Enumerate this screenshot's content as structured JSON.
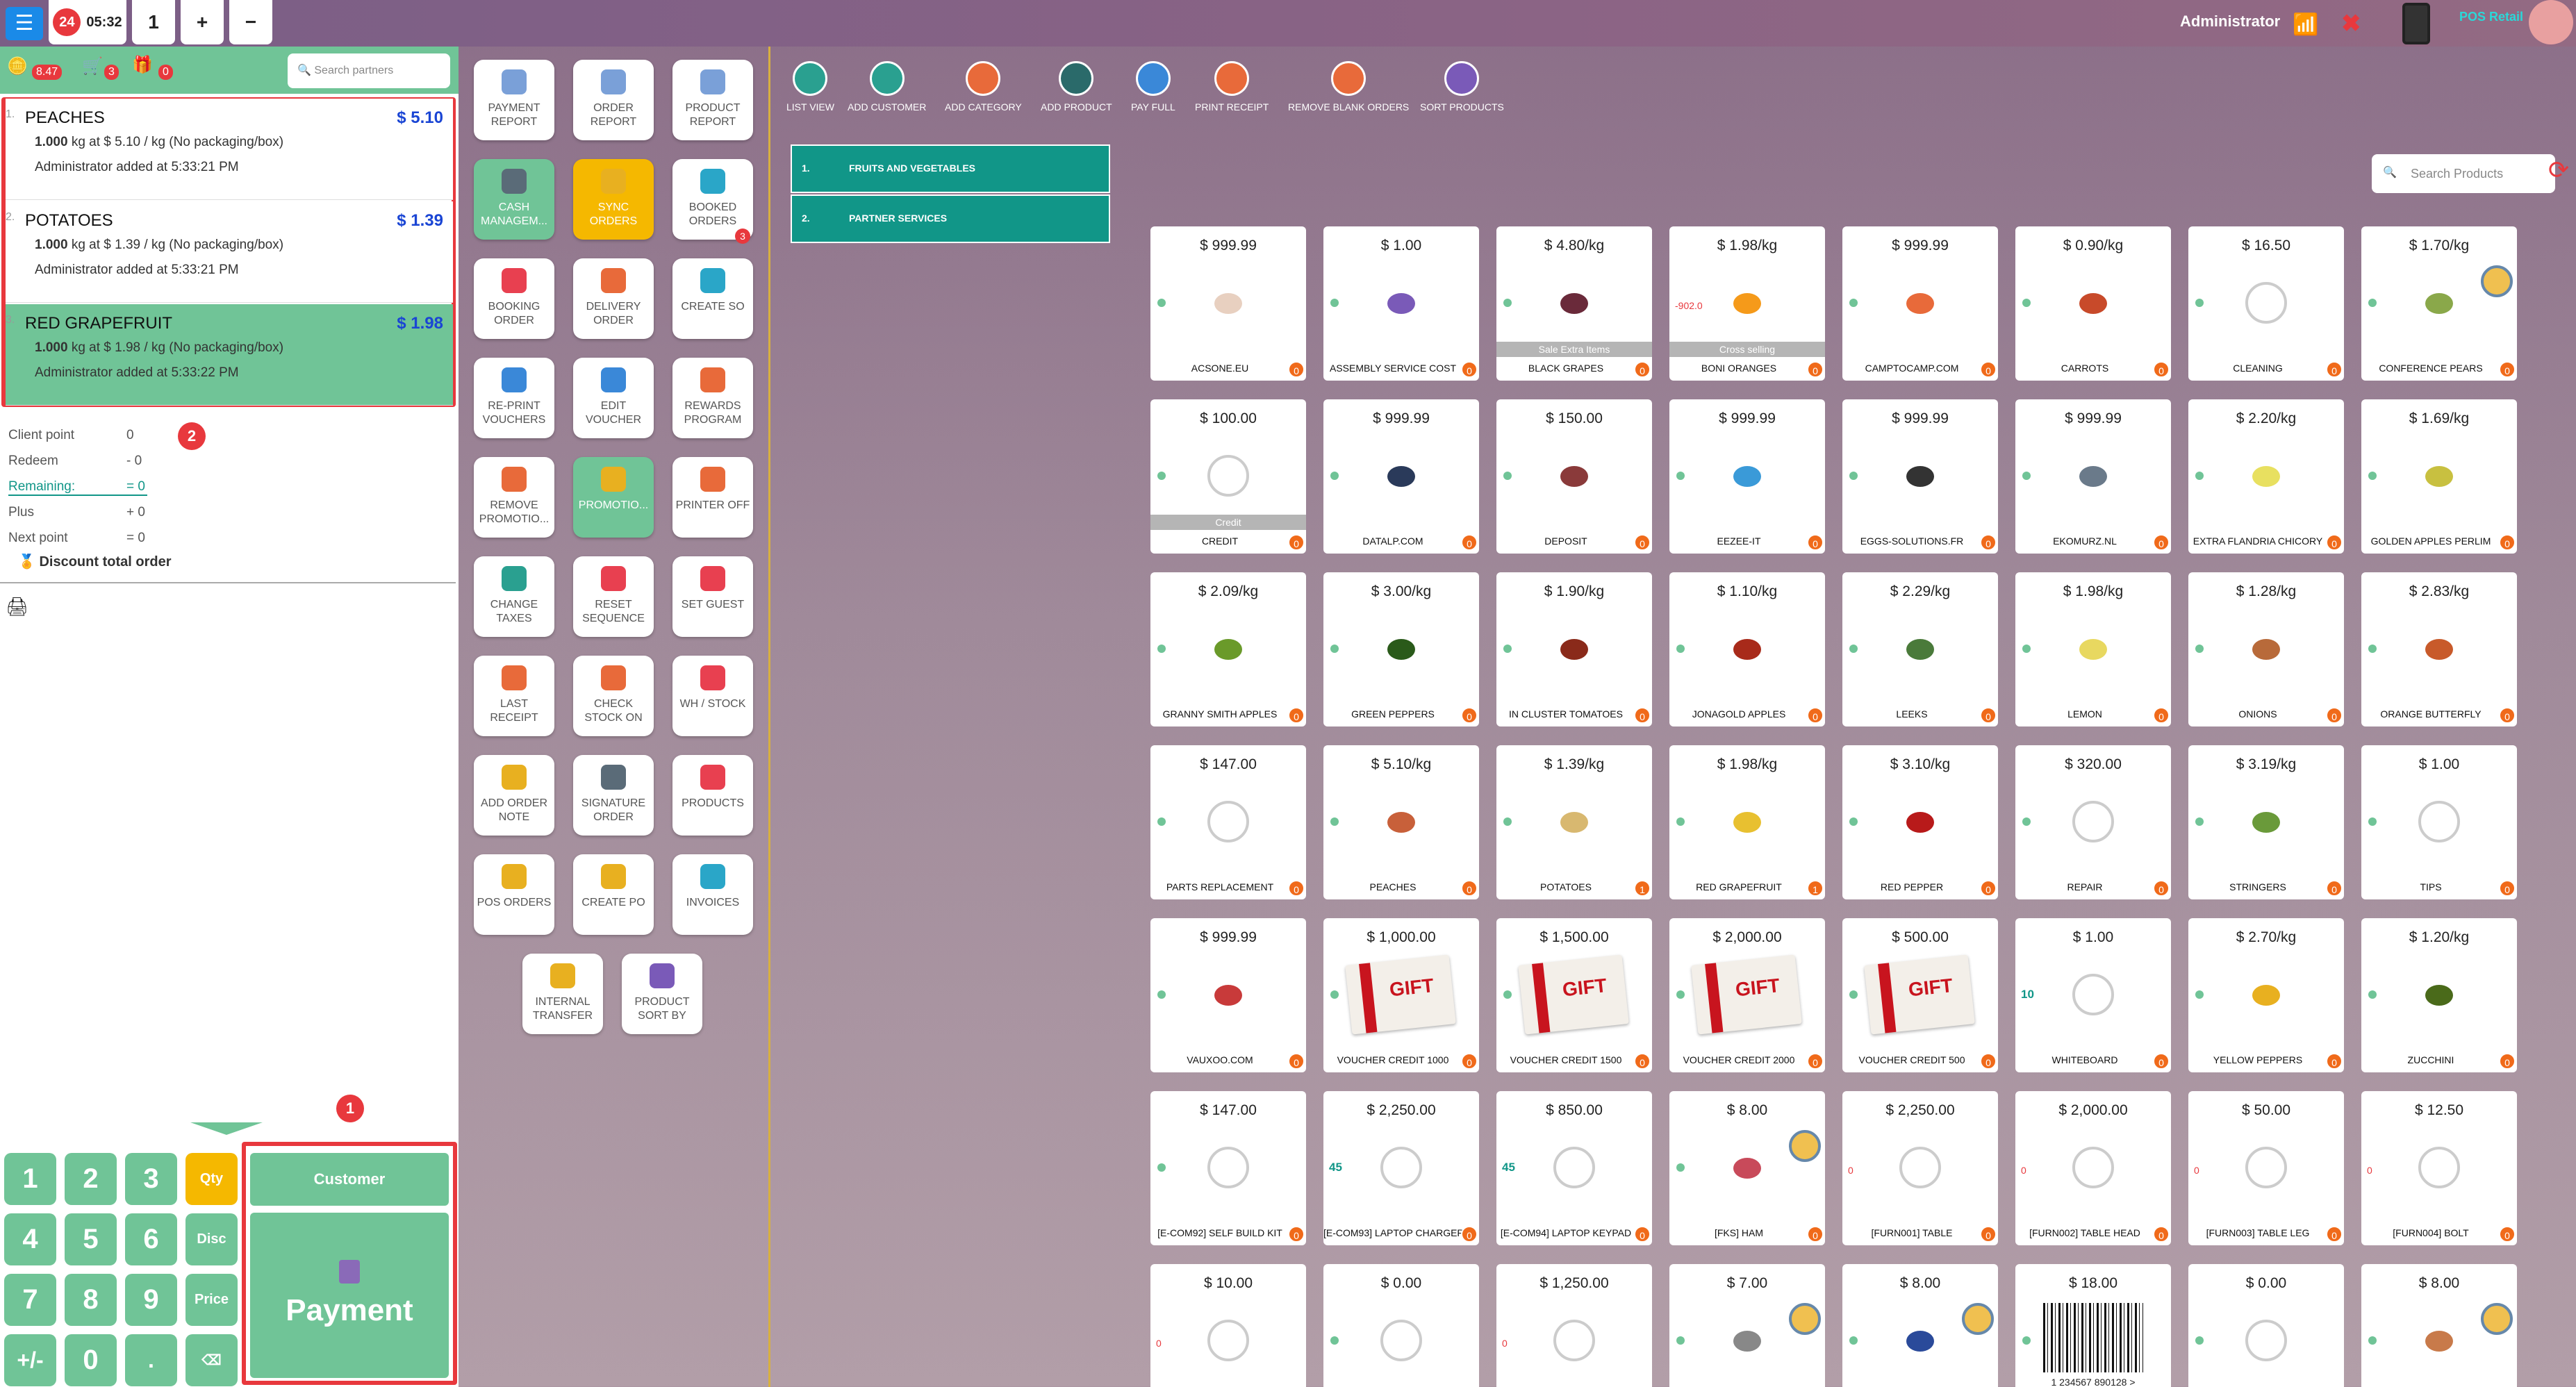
{
  "topbar": {
    "order_count": "24",
    "time": "05:32",
    "order_tab": "1",
    "add_label": "+",
    "remove_label": "−",
    "user": "Administrator",
    "brand": "POS Retail"
  },
  "partner_bar": {
    "points": "8.47",
    "gifts_a": "3",
    "gifts_b": "0",
    "search_placeholder": "Search partners"
  },
  "order_lines": [
    {
      "index": "1.",
      "name": "PEACHES",
      "price": "$ 5.10",
      "qty": "1.000",
      "detail": " kg at $ 5.10 / kg (No packaging/box)",
      "added": "Administrator added at 5:33:21 PM"
    },
    {
      "index": "2.",
      "name": "POTATOES",
      "price": "$ 1.39",
      "qty": "1.000",
      "detail": " kg at $ 1.39 / kg (No packaging/box)",
      "added": "Administrator added at 5:33:21 PM"
    },
    {
      "index": "3.",
      "name": "RED GRAPEFRUIT",
      "price": "$ 1.98",
      "qty": "1.000",
      "detail": " kg at $ 1.98 / kg (No packaging/box)",
      "added": "Administrator added at 5:33:22 PM"
    }
  ],
  "points": [
    {
      "label": "Client point",
      "value": "0"
    },
    {
      "label": "Redeem",
      "value": "- 0"
    },
    {
      "label": "Remaining:",
      "value": "= 0"
    },
    {
      "label": "Plus",
      "value": "+ 0"
    },
    {
      "label": "Next point",
      "value": "= 0"
    }
  ],
  "discount_label": "Discount total order",
  "callouts": {
    "one": "1",
    "two": "2"
  },
  "numpad": {
    "keys": [
      "1",
      "2",
      "3",
      "4",
      "5",
      "6",
      "7",
      "8",
      "9",
      "+/-",
      "0",
      "."
    ],
    "qty": "Qty",
    "disc": "Disc",
    "price": "Price",
    "backspace": "⌫",
    "customer": "Customer",
    "payment": "Payment"
  },
  "controls": [
    {
      "label": "PAYMENT REPORT",
      "color": "#7aa0d8"
    },
    {
      "label": "ORDER REPORT",
      "color": "#7aa0d8"
    },
    {
      "label": "PRODUCT REPORT",
      "color": "#7aa0d8"
    },
    {
      "label": "CASH MANAGEM...",
      "color": "#5a6b78",
      "style": "g"
    },
    {
      "label": "SYNC ORDERS",
      "color": "#e8b020",
      "style": "y"
    },
    {
      "label": "BOOKED ORDERS",
      "color": "#2aa6c8",
      "sub": "3"
    },
    {
      "label": "BOOKING ORDER",
      "color": "#e84050"
    },
    {
      "label": "DELIVERY ORDER",
      "color": "#e86a3a"
    },
    {
      "label": "CREATE SO",
      "color": "#2aa6c8"
    },
    {
      "label": "RE-PRINT VOUCHERS",
      "color": "#3a88d8"
    },
    {
      "label": "EDIT VOUCHER",
      "color": "#3a88d8"
    },
    {
      "label": "REWARDS PROGRAM",
      "color": "#e86a3a"
    },
    {
      "label": "REMOVE PROMOTIO...",
      "color": "#e86a3a"
    },
    {
      "label": "PROMOTIO...",
      "color": "#e8b020",
      "style": "g"
    },
    {
      "label": "PRINTER OFF",
      "color": "#e86a3a"
    },
    {
      "label": "CHANGE TAXES",
      "color": "#2aa090"
    },
    {
      "label": "RESET SEQUENCE",
      "color": "#e84050"
    },
    {
      "label": "SET GUEST",
      "color": "#e84050"
    },
    {
      "label": "LAST RECEIPT",
      "color": "#e86a3a"
    },
    {
      "label": "CHECK STOCK ON",
      "color": "#e86a3a"
    },
    {
      "label": "WH / STOCK",
      "color": "#e84050"
    },
    {
      "label": "ADD ORDER NOTE",
      "color": "#e8b020"
    },
    {
      "label": "SIGNATURE ORDER",
      "color": "#5a6b78"
    },
    {
      "label": "PRODUCTS",
      "color": "#e84050"
    },
    {
      "label": "POS ORDERS",
      "color": "#e8b020"
    },
    {
      "label": "CREATE PO",
      "color": "#e8b020"
    },
    {
      "label": "INVOICES",
      "color": "#2aa6c8"
    },
    {
      "label": "INTERNAL TRANSFER",
      "color": "#e8b020"
    },
    {
      "label": "PRODUCT SORT BY",
      "color": "#7a5ab8"
    }
  ],
  "toolbar": [
    {
      "label": "LIST VIEW",
      "color": "#2aa090"
    },
    {
      "label": "ADD CUSTOMER",
      "color": "#2aa090"
    },
    {
      "label": "ADD CATEGORY",
      "color": "#e86a3a"
    },
    {
      "label": "ADD PRODUCT",
      "color": "#2a6a6a"
    },
    {
      "label": "PAY FULL",
      "color": "#3a88d8"
    },
    {
      "label": "PRINT RECEIPT",
      "color": "#e86a3a"
    },
    {
      "label": "REMOVE BLANK ORDERS",
      "color": "#e86a3a"
    },
    {
      "label": "SORT PRODUCTS",
      "color": "#7a5ab8"
    }
  ],
  "categories": [
    {
      "index": "1.",
      "name": "FRUITS AND VEGETABLES"
    },
    {
      "index": "2.",
      "name": "PARTNER SERVICES"
    }
  ],
  "search_products": "Search Products",
  "products": [
    {
      "price": "$ 999.99",
      "name": "ACSONE.EU",
      "q": "0",
      "img": "#e8d0c0"
    },
    {
      "price": "$ 1.00",
      "name": "ASSEMBLY SERVICE COST",
      "q": "0",
      "img": "#7a5ab8"
    },
    {
      "price": "$ 4.80/kg",
      "name": "BLACK GRAPES",
      "q": "0",
      "img": "#6a2a3a",
      "over": "Sale Extra Items"
    },
    {
      "price": "$ 1.98/kg",
      "name": "BONI ORANGES",
      "q": "0",
      "img": "#f59a1a",
      "over": "Cross selling",
      "lock": "-902.0"
    },
    {
      "price": "$ 999.99",
      "name": "CAMPTOCAMP.COM",
      "q": "0",
      "img": "#e86a3a"
    },
    {
      "price": "$ 0.90/kg",
      "name": "CARROTS",
      "q": "0",
      "img": "#c84a2a"
    },
    {
      "price": "$ 16.50",
      "name": "CLEANING",
      "q": "0",
      "cam": true
    },
    {
      "price": "$ 1.70/kg",
      "name": "CONFERENCE PEARS",
      "q": "0",
      "img": "#8aa84a",
      "coin": true
    },
    {
      "price": "$ 100.00",
      "name": "CREDIT",
      "q": "0",
      "cam": true,
      "over": "Credit"
    },
    {
      "price": "$ 999.99",
      "name": "DATALP.COM",
      "q": "0",
      "img": "#2a3a5a"
    },
    {
      "price": "$ 150.00",
      "name": "DEPOSIT",
      "q": "0",
      "img": "#8a3a3a"
    },
    {
      "price": "$ 999.99",
      "name": "EEZEE-IT",
      "q": "0",
      "img": "#3a9ad8"
    },
    {
      "price": "$ 999.99",
      "name": "EGGS-SOLUTIONS.FR",
      "q": "0",
      "img": "#333333"
    },
    {
      "price": "$ 999.99",
      "name": "EKOMURZ.NL",
      "q": "0",
      "img": "#6a7a8a"
    },
    {
      "price": "$ 2.20/kg",
      "name": "EXTRA FLANDRIA CHICORY",
      "q": "0",
      "img": "#e8e060"
    },
    {
      "price": "$ 1.69/kg",
      "name": "GOLDEN APPLES PERLIM",
      "q": "0",
      "img": "#c8c040"
    },
    {
      "price": "$ 2.09/kg",
      "name": "GRANNY SMITH APPLES",
      "q": "0",
      "img": "#6a9a2a"
    },
    {
      "price": "$ 3.00/kg",
      "name": "GREEN PEPPERS",
      "q": "0",
      "img": "#2a5a1a"
    },
    {
      "price": "$ 1.90/kg",
      "name": "IN CLUSTER TOMATOES",
      "q": "0",
      "img": "#8a2a1a"
    },
    {
      "price": "$ 1.10/kg",
      "name": "JONAGOLD APPLES",
      "q": "0",
      "img": "#a82a1a"
    },
    {
      "price": "$ 2.29/kg",
      "name": "LEEKS",
      "q": "0",
      "img": "#4a7a3a"
    },
    {
      "price": "$ 1.98/kg",
      "name": "LEMON",
      "q": "0",
      "img": "#e8d860"
    },
    {
      "price": "$ 1.28/kg",
      "name": "ONIONS",
      "q": "0",
      "img": "#b86a3a"
    },
    {
      "price": "$ 2.83/kg",
      "name": "ORANGE BUTTERFLY",
      "q": "0",
      "img": "#c85a2a"
    },
    {
      "price": "$ 147.00",
      "name": "PARTS REPLACEMENT",
      "q": "0",
      "cam": true
    },
    {
      "price": "$ 5.10/kg",
      "name": "PEACHES",
      "q": "0",
      "img": "#c8603a"
    },
    {
      "price": "$ 1.39/kg",
      "name": "POTATOES",
      "q": "1",
      "img": "#d8b870"
    },
    {
      "price": "$ 1.98/kg",
      "name": "RED GRAPEFRUIT",
      "q": "1",
      "img": "#e8c030"
    },
    {
      "price": "$ 3.10/kg",
      "name": "RED PEPPER",
      "q": "0",
      "img": "#b81a1a"
    },
    {
      "price": "$ 320.00",
      "name": "REPAIR",
      "q": "0",
      "cam": true
    },
    {
      "price": "$ 3.19/kg",
      "name": "STRINGERS",
      "q": "0",
      "img": "#6a9a3a"
    },
    {
      "price": "$ 1.00",
      "name": "TIPS",
      "q": "0",
      "cam": true
    },
    {
      "price": "$ 999.99",
      "name": "VAUXOO.COM",
      "q": "0",
      "img": "#c83a3a"
    },
    {
      "price": "$ 1,000.00",
      "name": "VOUCHER CREDIT 1000",
      "q": "0",
      "gift": true
    },
    {
      "price": "$ 1,500.00",
      "name": "VOUCHER CREDIT 1500",
      "q": "0",
      "gift": true
    },
    {
      "price": "$ 2,000.00",
      "name": "VOUCHER CREDIT 2000",
      "q": "0",
      "gift": true
    },
    {
      "price": "$ 500.00",
      "name": "VOUCHER CREDIT 500",
      "q": "0",
      "gift": true
    },
    {
      "price": "$ 1.00",
      "name": "WHITEBOARD",
      "q": "0",
      "cam": true,
      "stock": "10"
    },
    {
      "price": "$ 2.70/kg",
      "name": "YELLOW PEPPERS",
      "q": "0",
      "img": "#e8b020"
    },
    {
      "price": "$ 1.20/kg",
      "name": "ZUCCHINI",
      "q": "0",
      "img": "#4a6a1a"
    },
    {
      "price": "$ 147.00",
      "name": "[E-COM92] SELF BUILD KIT",
      "q": "0",
      "cam": true
    },
    {
      "price": "$ 2,250.00",
      "name": "[E-COM93] LAPTOP CHARGER",
      "q": "0",
      "cam": true,
      "stock": "45"
    },
    {
      "price": "$ 850.00",
      "name": "[E-COM94] LAPTOP KEYPAD",
      "q": "0",
      "cam": true,
      "stock": "45"
    },
    {
      "price": "$ 8.00",
      "name": "[FKS] HAM",
      "q": "0",
      "img": "#c84a5a",
      "coin": true
    },
    {
      "price": "$ 2,250.00",
      "name": "[FURN001] TABLE",
      "q": "0",
      "cam": true,
      "lock": "0"
    },
    {
      "price": "$ 2,000.00",
      "name": "[FURN002] TABLE HEAD",
      "q": "0",
      "cam": true,
      "lock": "0"
    },
    {
      "price": "$ 50.00",
      "name": "[FURN003] TABLE LEG",
      "q": "0",
      "cam": true,
      "lock": "0"
    },
    {
      "price": "$ 12.50",
      "name": "[FURN004] BOLT",
      "q": "0",
      "cam": true,
      "lock": "0"
    },
    {
      "price": "$ 10.00",
      "name": "",
      "q": "",
      "cam": true,
      "lock": "0"
    },
    {
      "price": "$ 0.00",
      "name": "",
      "q": "",
      "cam": true
    },
    {
      "price": "$ 1,250.00",
      "name": "",
      "q": "",
      "cam": true,
      "lock": "0"
    },
    {
      "price": "$ 7.00",
      "name": "",
      "q": "",
      "img": "#888888",
      "coin": true
    },
    {
      "price": "$ 8.00",
      "name": "",
      "q": "",
      "img": "#2a4a9a",
      "coin": true
    },
    {
      "price": "$ 18.00",
      "name": "",
      "q": "",
      "barcode": "1 234567 890128 >"
    },
    {
      "price": "$ 0.00",
      "name": "",
      "q": "",
      "cam": true
    },
    {
      "price": "$ 8.00",
      "name": "",
      "q": "",
      "img": "#c87a4a",
      "coin": true
    }
  ]
}
